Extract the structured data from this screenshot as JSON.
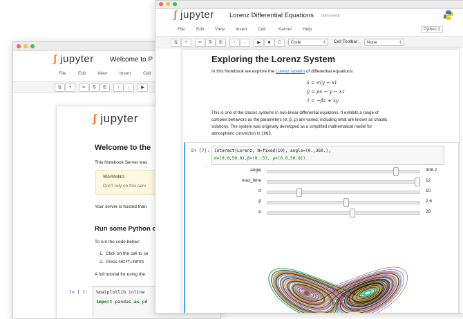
{
  "back": {
    "logo": "jupyter",
    "title": "Welcome to P",
    "menu": [
      "File",
      "Edit",
      "View",
      "Insert",
      "Cell"
    ],
    "toolbar_icons": [
      "save-icon",
      "add-icon",
      "cut-icon",
      "copy-icon",
      "paste-icon",
      "up-icon",
      "down-icon",
      "run-icon"
    ],
    "toolbar_glyphs": [
      "🖫",
      "+",
      "✂",
      "⎘",
      "⎗",
      "↑",
      "↓",
      "▶"
    ],
    "nb_logo": "jupyter",
    "heading": "Welcome to the",
    "intro": "This Notebook Server was",
    "warning_title": "WARNING",
    "warning_text": "Don't rely on this serv",
    "hosted": "Your server is hosted than",
    "h2": "Run some Python c",
    "run_text": "To run the code below:",
    "list1": "Click on the cell to se",
    "list2_pre": "Press ",
    "list2_code": "SHIFT+ENTER",
    "tutorial": "A full tutorial for using the",
    "prompt": "In [ ]:",
    "code1": "%matplotlib inline",
    "code2_kw": "import",
    "code2_mid": " pandas ",
    "code2_kw2": "as",
    "code2_end": " pd"
  },
  "front": {
    "logo": "jupyter",
    "title": "Lorenz Differential Equations",
    "autosaved": "(autosaved)",
    "menu": [
      "File",
      "Edit",
      "View",
      "Insert",
      "Cell",
      "Kernel",
      "Help"
    ],
    "kernel": "Python 3",
    "toolbar_icons": [
      "save-icon",
      "add-icon",
      "cut-icon",
      "copy-icon",
      "paste-icon",
      "up-icon",
      "down-icon",
      "run-icon",
      "stop-icon",
      "restart-icon"
    ],
    "toolbar_glyphs": [
      "🖫",
      "+",
      "✂",
      "⎘",
      "⎗",
      "↑",
      "↓",
      "▶",
      "■",
      "C"
    ],
    "cell_type": "Code",
    "cell_toolbar_label": "Cell Toolbar:",
    "cell_toolbar_value": "None",
    "heading": "Exploring the Lorenz System",
    "intro_pre": "In this Notebook we explore the ",
    "intro_link": "Lorenz system",
    "intro_post": " of differential equations:",
    "eq1": "ẋ = σ(y − x)",
    "eq2": "ẏ = ρx − y − xz",
    "eq3": "ż = −βz + xy",
    "para1": "This is one of the classic systems in non-linear differential equations. It exhibits a range of",
    "para2": "complex behaviors as the parameters (σ, β, ρ) are varied, including what are known as chaotic",
    "para3": "solutions. The system was originally developed as a simplified mathematical model for",
    "para4": "atmospheric convection in 1963.",
    "prompt": "In [7]:",
    "code_line1": "interact(Lorenz, N=fixed(10), angle=(0.,360.),",
    "code_line2": "         σ=(0.0,50.0),β=(0.,5), ρ=(0.0,50.0))",
    "sliders": [
      {
        "label": "angle",
        "value": "308.2",
        "frac": 0.856
      },
      {
        "label": "max_time",
        "value": "12",
        "frac": 1.0
      },
      {
        "label": "σ",
        "value": "10",
        "frac": 0.2
      },
      {
        "label": "β",
        "value": "2.6",
        "frac": 0.52
      },
      {
        "label": "ρ",
        "value": "28",
        "frac": 0.56
      }
    ],
    "colors": {
      "accent": "#f37726",
      "link": "#1a6bc9",
      "code_green": "#008000",
      "code_kw": "#008000"
    }
  }
}
